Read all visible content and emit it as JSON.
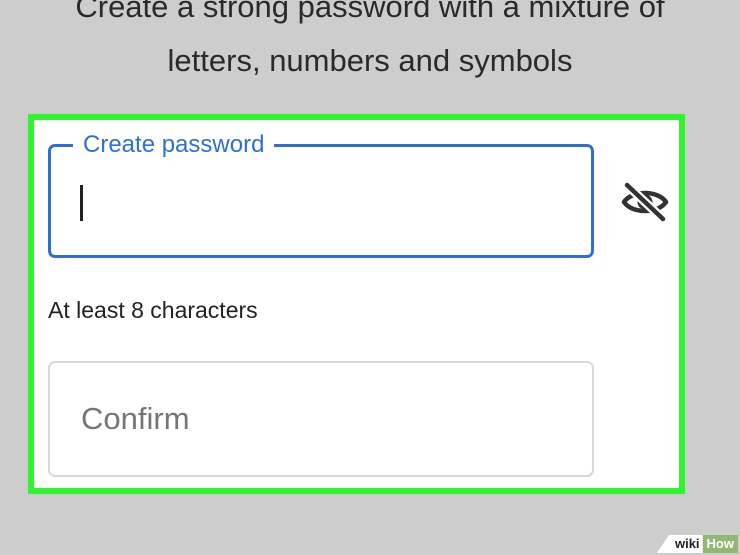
{
  "instructions": {
    "line1": "Create a strong password with a mixture of",
    "line2": "letters, numbers and symbols"
  },
  "password_field": {
    "label": "Create password",
    "value": "",
    "toggle_icon": "eye-off-icon"
  },
  "helper_text": "At least 8 characters",
  "confirm_field": {
    "placeholder": "Confirm",
    "value": ""
  },
  "watermark": {
    "part1": "wiki",
    "part2": "How"
  },
  "colors": {
    "background": "#cdcdcd",
    "panel": "#ffffff",
    "highlight_border": "#2ef52e",
    "focus_blue": "#2f6fd3",
    "text": "#222222",
    "placeholder": "#757575",
    "watermark_green": "#93b874"
  }
}
